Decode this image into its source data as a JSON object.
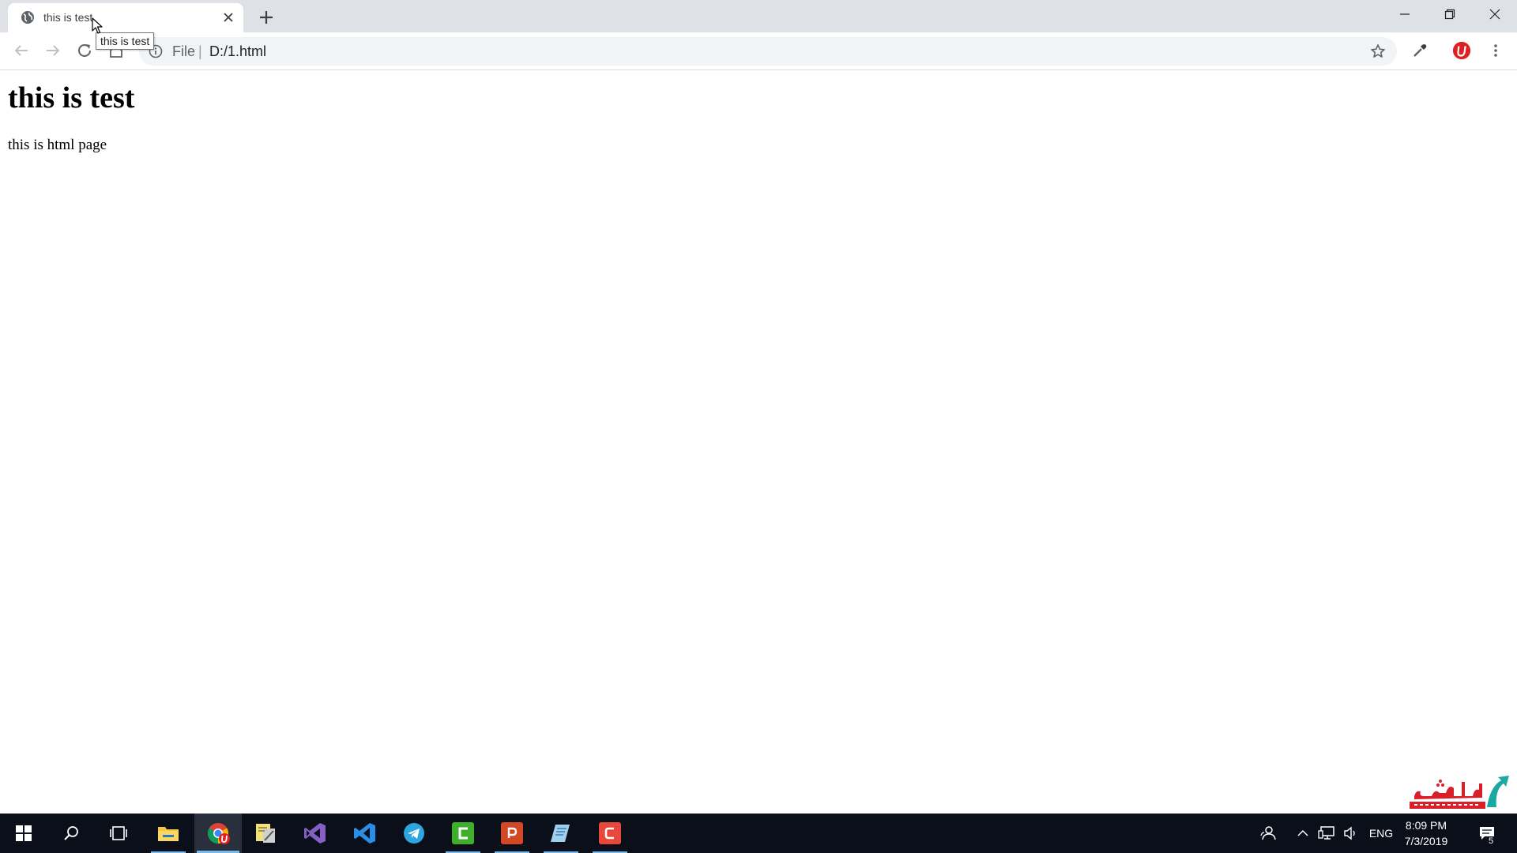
{
  "tab": {
    "title": "this is test",
    "tooltip": "this is test"
  },
  "toolbar": {
    "scheme": "File",
    "separator": "|",
    "url": "D:/1.html"
  },
  "page": {
    "heading": "this is test",
    "paragraph": "this is html page"
  },
  "taskbar": {
    "apps": [
      "start-icon",
      "search-icon",
      "task-view-icon",
      "file-explorer-icon",
      "chrome-icon",
      "sticky-notes-icon",
      "visual-studio-icon",
      "vscode-icon",
      "telegram-icon",
      "camtasia-icon",
      "powerpoint-icon",
      "notepad-icon",
      "adobe-connect-icon"
    ],
    "language": "ENG",
    "time": "8:09 PM",
    "date": "7/3/2019",
    "notification_count": "5"
  },
  "colors": {
    "tabstrip": "#dee1e6",
    "omnibox": "#f1f3f4",
    "taskbar": "#0b0f1a",
    "taskbar_accent": "#76b9ed"
  }
}
